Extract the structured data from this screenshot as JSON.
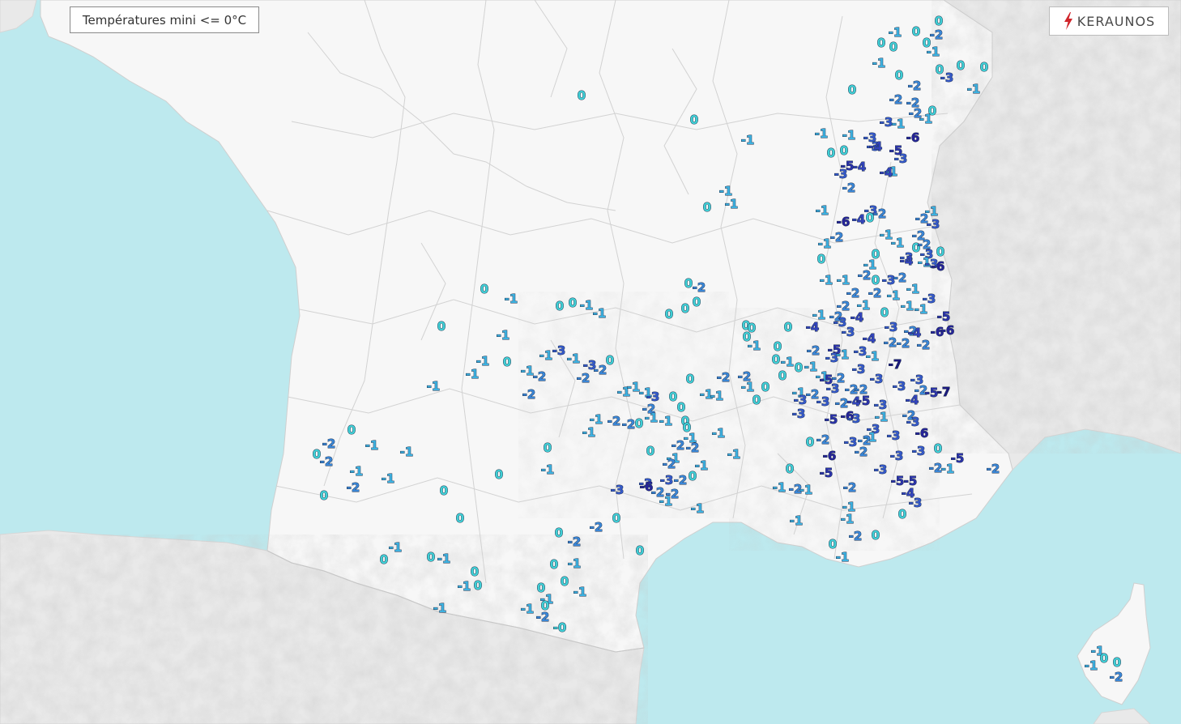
{
  "title": "Températures mini <= 0°C",
  "brand": "KERAUNOS",
  "colors": {
    "sea": "#bde9ee",
    "land": "#f7f7f7",
    "foreign": "#e9e9e9",
    "border": "#d2d2d2",
    "t0": "#3fd0d6",
    "t1": "#3db1e0",
    "t2": "#3a86d6",
    "t3": "#3559c9",
    "t4": "#3344bb",
    "t5": "#2c33aa",
    "t6": "#26249a",
    "t7": "#1c1a80",
    "outline": "#1e2f4a",
    "brand_red": "#d0252b"
  },
  "icons": {
    "brand": "lightning-bolt-icon"
  },
  "observations": [
    [
      "0",
      1159,
      26
    ],
    [
      "-1",
      1105,
      40
    ],
    [
      "0",
      1131,
      39
    ],
    [
      "-2",
      1156,
      43
    ],
    [
      "0",
      1088,
      53
    ],
    [
      "0",
      1103,
      58
    ],
    [
      "0",
      1144,
      53
    ],
    [
      "-1",
      1152,
      64
    ],
    [
      "-1",
      1085,
      78
    ],
    [
      "0",
      1160,
      86
    ],
    [
      "0",
      1186,
      81
    ],
    [
      "0",
      1215,
      83
    ],
    [
      "-3",
      1169,
      96
    ],
    [
      "-1",
      1202,
      110
    ],
    [
      "0",
      1110,
      93
    ],
    [
      "-2",
      1129,
      106
    ],
    [
      "0",
      1052,
      111
    ],
    [
      "-2",
      1106,
      123
    ],
    [
      "-2",
      1127,
      127
    ],
    [
      "0",
      1151,
      137
    ],
    [
      "-2",
      1130,
      140
    ],
    [
      "-1",
      1143,
      147
    ],
    [
      "-3",
      1094,
      151
    ],
    [
      "-1",
      1109,
      153
    ],
    [
      "0",
      718,
      118
    ],
    [
      "0",
      857,
      148
    ],
    [
      "-1",
      923,
      173
    ],
    [
      "-1",
      1014,
      165
    ],
    [
      "-1",
      1048,
      167
    ],
    [
      "-3",
      1074,
      170
    ],
    [
      "-6",
      1127,
      170
    ],
    [
      "-3",
      1078,
      181
    ],
    [
      "-4",
      1081,
      181
    ],
    [
      "-5",
      1106,
      186
    ],
    [
      "-3",
      1112,
      196
    ],
    [
      "0",
      1026,
      189
    ],
    [
      "0",
      1042,
      186
    ],
    [
      "-5",
      1046,
      205
    ],
    [
      "-4",
      1061,
      206
    ],
    [
      "-3",
      1038,
      215
    ],
    [
      "-1",
      1100,
      212
    ],
    [
      "-4",
      1094,
      213
    ],
    [
      "-2",
      1048,
      232
    ],
    [
      "-1",
      896,
      236
    ],
    [
      "0",
      873,
      256
    ],
    [
      "-1",
      903,
      252
    ],
    [
      "-1",
      1015,
      260
    ],
    [
      "-3",
      1075,
      260
    ],
    [
      "-6",
      1041,
      274
    ],
    [
      "-4",
      1060,
      271
    ],
    [
      "0",
      1074,
      269
    ],
    [
      "-2",
      1086,
      264
    ],
    [
      "-1",
      1150,
      261
    ],
    [
      "-2",
      1138,
      270
    ],
    [
      "-3",
      1152,
      277
    ],
    [
      "-1",
      1018,
      301
    ],
    [
      "-2",
      1033,
      293
    ],
    [
      "-1",
      1094,
      290
    ],
    [
      "-1",
      1108,
      300
    ],
    [
      "-2",
      1134,
      291
    ],
    [
      "0",
      1131,
      306
    ],
    [
      "-2",
      1141,
      302
    ],
    [
      "-3",
      1144,
      314
    ],
    [
      "0",
      1161,
      311
    ],
    [
      "0",
      1081,
      314
    ],
    [
      "-1",
      1074,
      327
    ],
    [
      "-3",
      1119,
      318
    ],
    [
      "-4",
      1119,
      322
    ],
    [
      "-1",
      1141,
      324
    ],
    [
      "-3",
      1150,
      326
    ],
    [
      "-6",
      1158,
      329
    ],
    [
      "0",
      1014,
      320
    ],
    [
      "-1",
      1020,
      346
    ],
    [
      "-1",
      1041,
      346
    ],
    [
      "0",
      1081,
      346
    ],
    [
      "-2",
      1067,
      340
    ],
    [
      "-3",
      1097,
      346
    ],
    [
      "-2",
      1111,
      343
    ],
    [
      "-1",
      1127,
      357
    ],
    [
      "-2",
      1053,
      362
    ],
    [
      "-2",
      1080,
      362
    ],
    [
      "-1",
      1103,
      365
    ],
    [
      "-3",
      1147,
      369
    ],
    [
      "0",
      598,
      357
    ],
    [
      "-1",
      631,
      369
    ],
    [
      "0",
      691,
      378
    ],
    [
      "0",
      707,
      374
    ],
    [
      "-1",
      724,
      377
    ],
    [
      "-1",
      740,
      387
    ],
    [
      "0",
      850,
      350
    ],
    [
      "-2",
      863,
      355
    ],
    [
      "0",
      826,
      388
    ],
    [
      "0",
      846,
      381
    ],
    [
      "0",
      860,
      373
    ],
    [
      "-2",
      1041,
      378
    ],
    [
      "-1",
      1066,
      377
    ],
    [
      "-1",
      1011,
      389
    ],
    [
      "-2",
      1032,
      391
    ],
    [
      "-4",
      1058,
      392
    ],
    [
      "0",
      1092,
      386
    ],
    [
      "-1",
      1120,
      378
    ],
    [
      "-1",
      1137,
      382
    ],
    [
      "-5",
      1165,
      391
    ],
    [
      "0",
      545,
      403
    ],
    [
      "-1",
      621,
      414
    ],
    [
      "0",
      921,
      402
    ],
    [
      "0",
      928,
      405
    ],
    [
      "0",
      973,
      404
    ],
    [
      "-4",
      1003,
      404
    ],
    [
      "-3",
      1037,
      398
    ],
    [
      "-3",
      1047,
      410
    ],
    [
      "-3",
      1100,
      404
    ],
    [
      "-2",
      1124,
      409
    ],
    [
      "-4",
      1129,
      411
    ],
    [
      "-6",
      1157,
      410
    ],
    [
      "-6",
      1170,
      408
    ],
    [
      "-1",
      931,
      427
    ],
    [
      "0",
      922,
      416
    ],
    [
      "0",
      960,
      428
    ],
    [
      "-4",
      1073,
      418
    ],
    [
      "-2",
      1099,
      423
    ],
    [
      "-2",
      1115,
      424
    ],
    [
      "-2",
      1140,
      426
    ],
    [
      "-7",
      1105,
      450
    ],
    [
      "-3",
      690,
      433
    ],
    [
      "-1",
      674,
      439
    ],
    [
      "-1",
      708,
      443
    ],
    [
      "-3",
      728,
      451
    ],
    [
      "0",
      753,
      445
    ],
    [
      "-2",
      741,
      457
    ],
    [
      "-2",
      720,
      467
    ],
    [
      "0",
      626,
      447
    ],
    [
      "-1",
      596,
      446
    ],
    [
      "-1",
      583,
      462
    ],
    [
      "-1",
      651,
      458
    ],
    [
      "-2",
      666,
      465
    ],
    [
      "-1",
      535,
      477
    ],
    [
      "-2",
      653,
      487
    ],
    [
      "0",
      958,
      444
    ],
    [
      "-1",
      972,
      447
    ],
    [
      "0",
      986,
      454
    ],
    [
      "-1",
      1001,
      453
    ],
    [
      "-2",
      1004,
      433
    ],
    [
      "-5",
      1030,
      432
    ],
    [
      "-3",
      1027,
      442
    ],
    [
      "-1",
      1040,
      438
    ],
    [
      "-3",
      1062,
      434
    ],
    [
      "-1",
      1077,
      440
    ],
    [
      "-3",
      1060,
      456
    ],
    [
      "-2",
      893,
      466
    ],
    [
      "0",
      852,
      468
    ],
    [
      "-2",
      919,
      465
    ],
    [
      "0",
      966,
      464
    ],
    [
      "-1",
      923,
      478
    ],
    [
      "0",
      945,
      478
    ],
    [
      "0",
      934,
      494
    ],
    [
      "-1",
      1015,
      465
    ],
    [
      "-5",
      1020,
      469
    ],
    [
      "-2",
      1035,
      467
    ],
    [
      "-3",
      1082,
      468
    ],
    [
      "-1",
      986,
      485
    ],
    [
      "-2",
      1003,
      487
    ],
    [
      "-3",
      1028,
      480
    ],
    [
      "-2",
      1051,
      481
    ],
    [
      "-2",
      1063,
      481
    ],
    [
      "-3",
      1110,
      477
    ],
    [
      "-3",
      1132,
      469
    ],
    [
      "-2",
      1137,
      482
    ],
    [
      "-5",
      1150,
      485
    ],
    [
      "-7",
      1165,
      484
    ],
    [
      "-1",
      770,
      484
    ],
    [
      "-1",
      782,
      478
    ],
    [
      "-1",
      797,
      485
    ],
    [
      "-3",
      806,
      490
    ],
    [
      "-1",
      872,
      487
    ],
    [
      "-1",
      885,
      489
    ],
    [
      "0",
      831,
      490
    ],
    [
      "0",
      841,
      503
    ],
    [
      "-2",
      801,
      505
    ],
    [
      "-3",
      988,
      494
    ],
    [
      "-3",
      1016,
      496
    ],
    [
      "-2",
      1039,
      498
    ],
    [
      "-4",
      1054,
      496
    ],
    [
      "-5",
      1066,
      495
    ],
    [
      "-3",
      1087,
      500
    ],
    [
      "-4",
      1126,
      494
    ],
    [
      "-3",
      986,
      511
    ],
    [
      "-1",
      736,
      518
    ],
    [
      "-2",
      758,
      520
    ],
    [
      "-2",
      776,
      524
    ],
    [
      "-1",
      727,
      534
    ],
    [
      "0",
      789,
      523
    ],
    [
      "-1",
      804,
      516
    ],
    [
      "-1",
      822,
      520
    ],
    [
      "0",
      846,
      520
    ],
    [
      "0",
      848,
      528
    ],
    [
      "-5",
      1026,
      518
    ],
    [
      "-6",
      1046,
      514
    ],
    [
      "-3",
      1054,
      517
    ],
    [
      "-1",
      1088,
      515
    ],
    [
      "-2",
      1122,
      513
    ],
    [
      "-3",
      1127,
      521
    ],
    [
      "-3",
      1078,
      530
    ],
    [
      "-1",
      852,
      541
    ],
    [
      "-1",
      887,
      535
    ],
    [
      "-1",
      1074,
      540
    ],
    [
      "-3",
      1103,
      538
    ],
    [
      "-6",
      1138,
      535
    ],
    [
      "0",
      434,
      531
    ],
    [
      "-2",
      406,
      548
    ],
    [
      "-1",
      459,
      550
    ],
    [
      "-1",
      502,
      558
    ],
    [
      "0",
      391,
      561
    ],
    [
      "-2",
      403,
      570
    ],
    [
      "0",
      676,
      553
    ],
    [
      "0",
      803,
      557
    ],
    [
      "-2",
      837,
      550
    ],
    [
      "-2",
      855,
      553
    ],
    [
      "-1",
      831,
      566
    ],
    [
      "-1",
      906,
      561
    ],
    [
      "0",
      1000,
      546
    ],
    [
      "-2",
      1016,
      543
    ],
    [
      "-3",
      1050,
      546
    ],
    [
      "-2",
      1067,
      544
    ],
    [
      "-2",
      1063,
      558
    ],
    [
      "-6",
      1024,
      563
    ],
    [
      "0",
      1158,
      554
    ],
    [
      "-3",
      1134,
      557
    ],
    [
      "-3",
      1107,
      563
    ],
    [
      "-5",
      1182,
      566
    ],
    [
      "-2",
      1155,
      578
    ],
    [
      "-1",
      1170,
      579
    ],
    [
      "-2",
      1226,
      579
    ],
    [
      "-1",
      440,
      582
    ],
    [
      "-1",
      479,
      591
    ],
    [
      "-1",
      676,
      580
    ],
    [
      "0",
      616,
      586
    ],
    [
      "-2",
      826,
      573
    ],
    [
      "-1",
      866,
      575
    ],
    [
      "0",
      855,
      588
    ],
    [
      "0",
      975,
      579
    ],
    [
      "-3",
      1087,
      580
    ],
    [
      "-5",
      1020,
      584
    ],
    [
      "-2",
      436,
      602
    ],
    [
      "0",
      400,
      612
    ],
    [
      "0",
      548,
      606
    ],
    [
      "-3",
      762,
      605
    ],
    [
      "-3",
      797,
      597
    ],
    [
      "-6",
      798,
      601
    ],
    [
      "-3",
      823,
      593
    ],
    [
      "-2",
      840,
      593
    ],
    [
      "-2",
      812,
      608
    ],
    [
      "-2",
      830,
      610
    ],
    [
      "-1",
      822,
      619
    ],
    [
      "-1",
      962,
      602
    ],
    [
      "-2",
      982,
      604
    ],
    [
      "-1",
      995,
      605
    ],
    [
      "-2",
      1049,
      602
    ],
    [
      "-5",
      1108,
      594
    ],
    [
      "-5",
      1124,
      594
    ],
    [
      "-4",
      1121,
      609
    ],
    [
      "-3",
      1130,
      621
    ],
    [
      "-1",
      861,
      628
    ],
    [
      "0",
      1114,
      635
    ],
    [
      "-1",
      1048,
      626
    ],
    [
      "0",
      568,
      640
    ],
    [
      "0",
      761,
      640
    ],
    [
      "-2",
      736,
      651
    ],
    [
      "-1",
      983,
      643
    ],
    [
      "-1",
      1046,
      641
    ],
    [
      "0",
      690,
      658
    ],
    [
      "-2",
      709,
      669
    ],
    [
      "-2",
      1056,
      662
    ],
    [
      "0",
      1081,
      661
    ],
    [
      "0",
      1028,
      672
    ],
    [
      "-1",
      1040,
      688
    ],
    [
      "-1",
      488,
      676
    ],
    [
      "0",
      474,
      691
    ],
    [
      "0",
      532,
      688
    ],
    [
      "-1",
      548,
      690
    ],
    [
      "0",
      790,
      680
    ],
    [
      "0",
      684,
      697
    ],
    [
      "-1",
      709,
      696
    ],
    [
      "0",
      586,
      706
    ],
    [
      "-1",
      573,
      724
    ],
    [
      "0",
      590,
      723
    ],
    [
      "0",
      697,
      718
    ],
    [
      "0",
      668,
      726
    ],
    [
      "-1",
      716,
      731
    ],
    [
      "-1",
      675,
      740
    ],
    [
      "-1",
      543,
      751
    ],
    [
      "-1",
      651,
      752
    ],
    [
      "0",
      673,
      748
    ],
    [
      "-2",
      670,
      762
    ],
    [
      "-0",
      691,
      775
    ],
    [
      "-1",
      1355,
      804
    ],
    [
      "0",
      1363,
      813
    ],
    [
      "0",
      1379,
      818
    ],
    [
      "-1",
      1347,
      822
    ],
    [
      "-2",
      1378,
      836
    ]
  ]
}
